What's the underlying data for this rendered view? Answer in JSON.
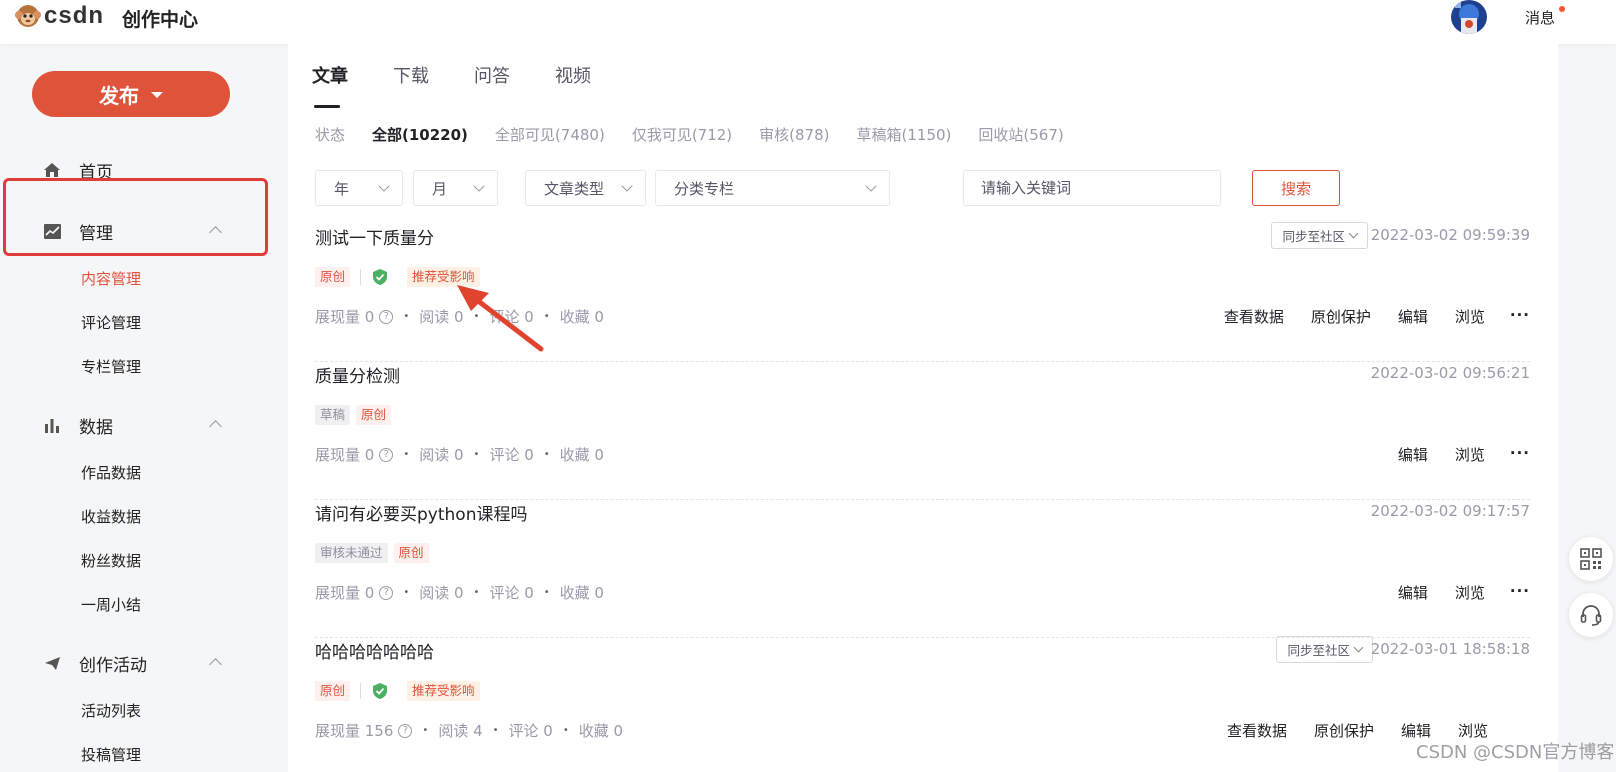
{
  "header": {
    "logo_text": "CSDN",
    "site_title": "创作中心",
    "messages_label": "消息"
  },
  "sidebar": {
    "publish_label": "发布",
    "home_label": "首页",
    "manage_label": "管理",
    "manage_items": [
      "内容管理",
      "评论管理",
      "专栏管理"
    ],
    "data_label": "数据",
    "data_items": [
      "作品数据",
      "收益数据",
      "粉丝数据",
      "一周小结"
    ],
    "activity_label": "创作活动",
    "activity_items": [
      "活动列表",
      "投稿管理"
    ]
  },
  "main": {
    "tabs": [
      "文章",
      "下载",
      "问答",
      "视频"
    ],
    "filters": [
      "状态",
      "全部(10220)",
      "全部可见(7480)",
      "仅我可见(712)",
      "审核(878)",
      "草稿箱(1150)",
      "回收站(567)"
    ],
    "select_year": "年",
    "select_month": "月",
    "select_type": "文章类型",
    "select_column": "分类专栏",
    "search_placeholder": "请输入关键词",
    "search_label": "搜索",
    "articles": [
      {
        "title": "测试一下质量分",
        "sync": "同步至社区",
        "time": "2022-03-02 09:59:39",
        "tag1": "原创",
        "tag2": "推荐受影响",
        "views": "展现量 0",
        "reads": "阅读 0",
        "comments": "评论 0",
        "favorites": "收藏 0",
        "act_data": "查看数据",
        "act_protect": "原创保护",
        "act_edit": "编辑",
        "act_view": "浏览",
        "more": "···"
      },
      {
        "title": "质量分检测",
        "time": "2022-03-02 09:56:21",
        "tag1": "草稿",
        "tag2": "原创",
        "views": "展现量 0",
        "reads": "阅读 0",
        "comments": "评论 0",
        "favorites": "收藏 0",
        "act_edit": "编辑",
        "act_view": "浏览",
        "more": "···"
      },
      {
        "title": "请问有必要买python课程吗",
        "time": "2022-03-02 09:17:57",
        "tag1": "审核未通过",
        "tag2": "原创",
        "views": "展现量 0",
        "reads": "阅读 0",
        "comments": "评论 0",
        "favorites": "收藏 0",
        "act_edit": "编辑",
        "act_view": "浏览",
        "more": "···"
      },
      {
        "title": "哈哈哈哈哈哈哈",
        "sync": "同步至社区",
        "time": "2022-03-01 18:58:18",
        "tag1": "原创",
        "tag2": "推荐受影响",
        "views": "展现量 156",
        "reads": "阅读 4",
        "comments": "评论 0",
        "favorites": "收藏 0",
        "act_data": "查看数据",
        "act_protect": "原创保护",
        "act_edit": "编辑",
        "act_view": "浏览"
      }
    ]
  },
  "watermark": "CSDN @CSDN官方博客",
  "colors": {
    "brand": "#e0533b",
    "highlight": "#e03c3c"
  }
}
